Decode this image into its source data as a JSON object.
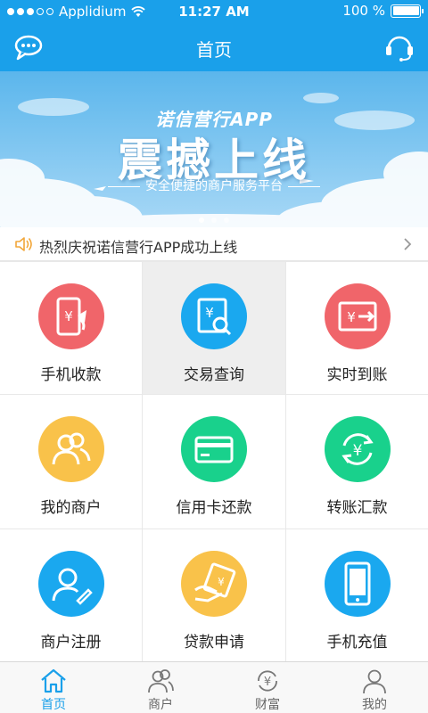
{
  "status_bar": {
    "carrier": "Applidium",
    "time": "11:27 AM",
    "battery": "100 %"
  },
  "nav": {
    "title": "首页"
  },
  "banner": {
    "app_name": "诺信营行APP",
    "headline": "震撼上线",
    "tagline": "安全便捷的商户服务平台"
  },
  "notice": {
    "text": "热烈庆祝诺信营行APP成功上线"
  },
  "grid": [
    {
      "label": "手机收款",
      "color": "#f0656a",
      "icon": "mobile-payment-icon"
    },
    {
      "label": "交易查询",
      "color": "#1aa8ef",
      "icon": "transaction-search-icon"
    },
    {
      "label": "实时到账",
      "color": "#f0656a",
      "icon": "realtime-arrival-icon"
    },
    {
      "label": "我的商户",
      "color": "#f9c24a",
      "icon": "merchants-icon"
    },
    {
      "label": "信用卡还款",
      "color": "#19d18c",
      "icon": "credit-card-icon"
    },
    {
      "label": "转账汇款",
      "color": "#19d18c",
      "icon": "transfer-icon"
    },
    {
      "label": "商户注册",
      "color": "#1aa8ef",
      "icon": "register-icon"
    },
    {
      "label": "贷款申请",
      "color": "#f9c24a",
      "icon": "loan-icon"
    },
    {
      "label": "手机充值",
      "color": "#1aa8ef",
      "icon": "phone-recharge-icon"
    }
  ],
  "tabs": [
    {
      "label": "首页",
      "icon": "home-icon",
      "active": true
    },
    {
      "label": "商户",
      "icon": "merchant-tab-icon",
      "active": false
    },
    {
      "label": "财富",
      "icon": "wealth-icon",
      "active": false
    },
    {
      "label": "我的",
      "icon": "profile-icon",
      "active": false
    }
  ],
  "colors": {
    "primary": "#1aa0ea",
    "red": "#f0656a",
    "blue": "#1aa8ef",
    "yellow": "#f9c24a",
    "green": "#19d18c"
  }
}
